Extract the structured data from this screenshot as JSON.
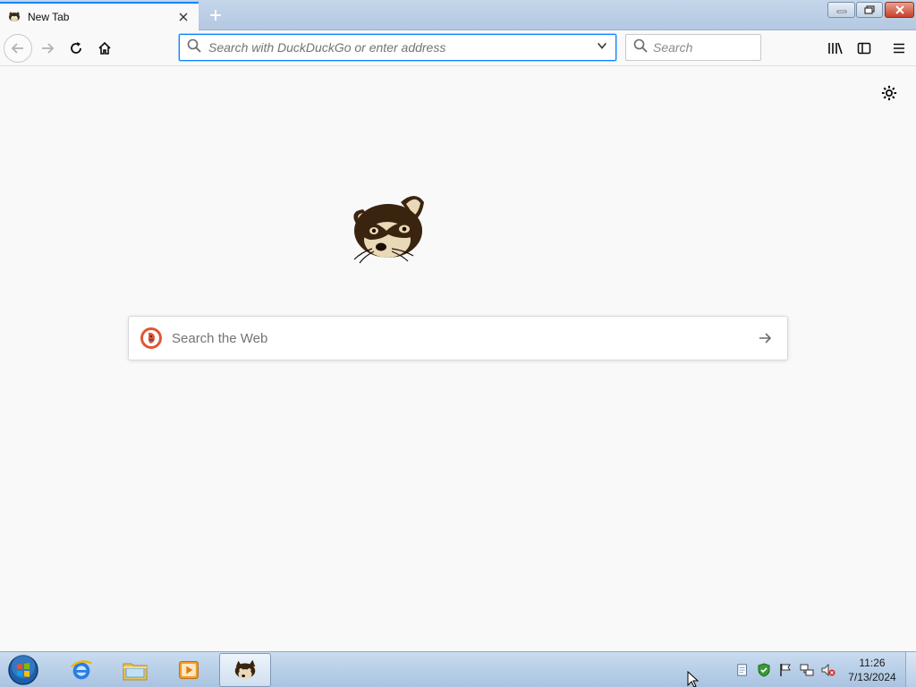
{
  "browser": {
    "tab": {
      "title": "New Tab"
    },
    "urlbar": {
      "placeholder": "Search with DuckDuckGo or enter address",
      "value": ""
    },
    "searchbar": {
      "placeholder": "Search"
    }
  },
  "content": {
    "websearch": {
      "placeholder": "Search the Web"
    }
  },
  "taskbar": {
    "clock": {
      "time": "11:26",
      "date": "7/13/2024"
    },
    "pinned": [
      "internet-explorer",
      "windows-explorer",
      "media-player",
      "firefox"
    ]
  },
  "colors": {
    "accent": "#0a84ff",
    "page_bg": "#f9f9fa",
    "taskbar": "#b9d0e8",
    "close_button": "#c8402a"
  },
  "icons": {
    "tab_favicon": "raccoon-icon",
    "mascot": "raccoon-mascot",
    "websearch": "duckduckgo-icon"
  }
}
